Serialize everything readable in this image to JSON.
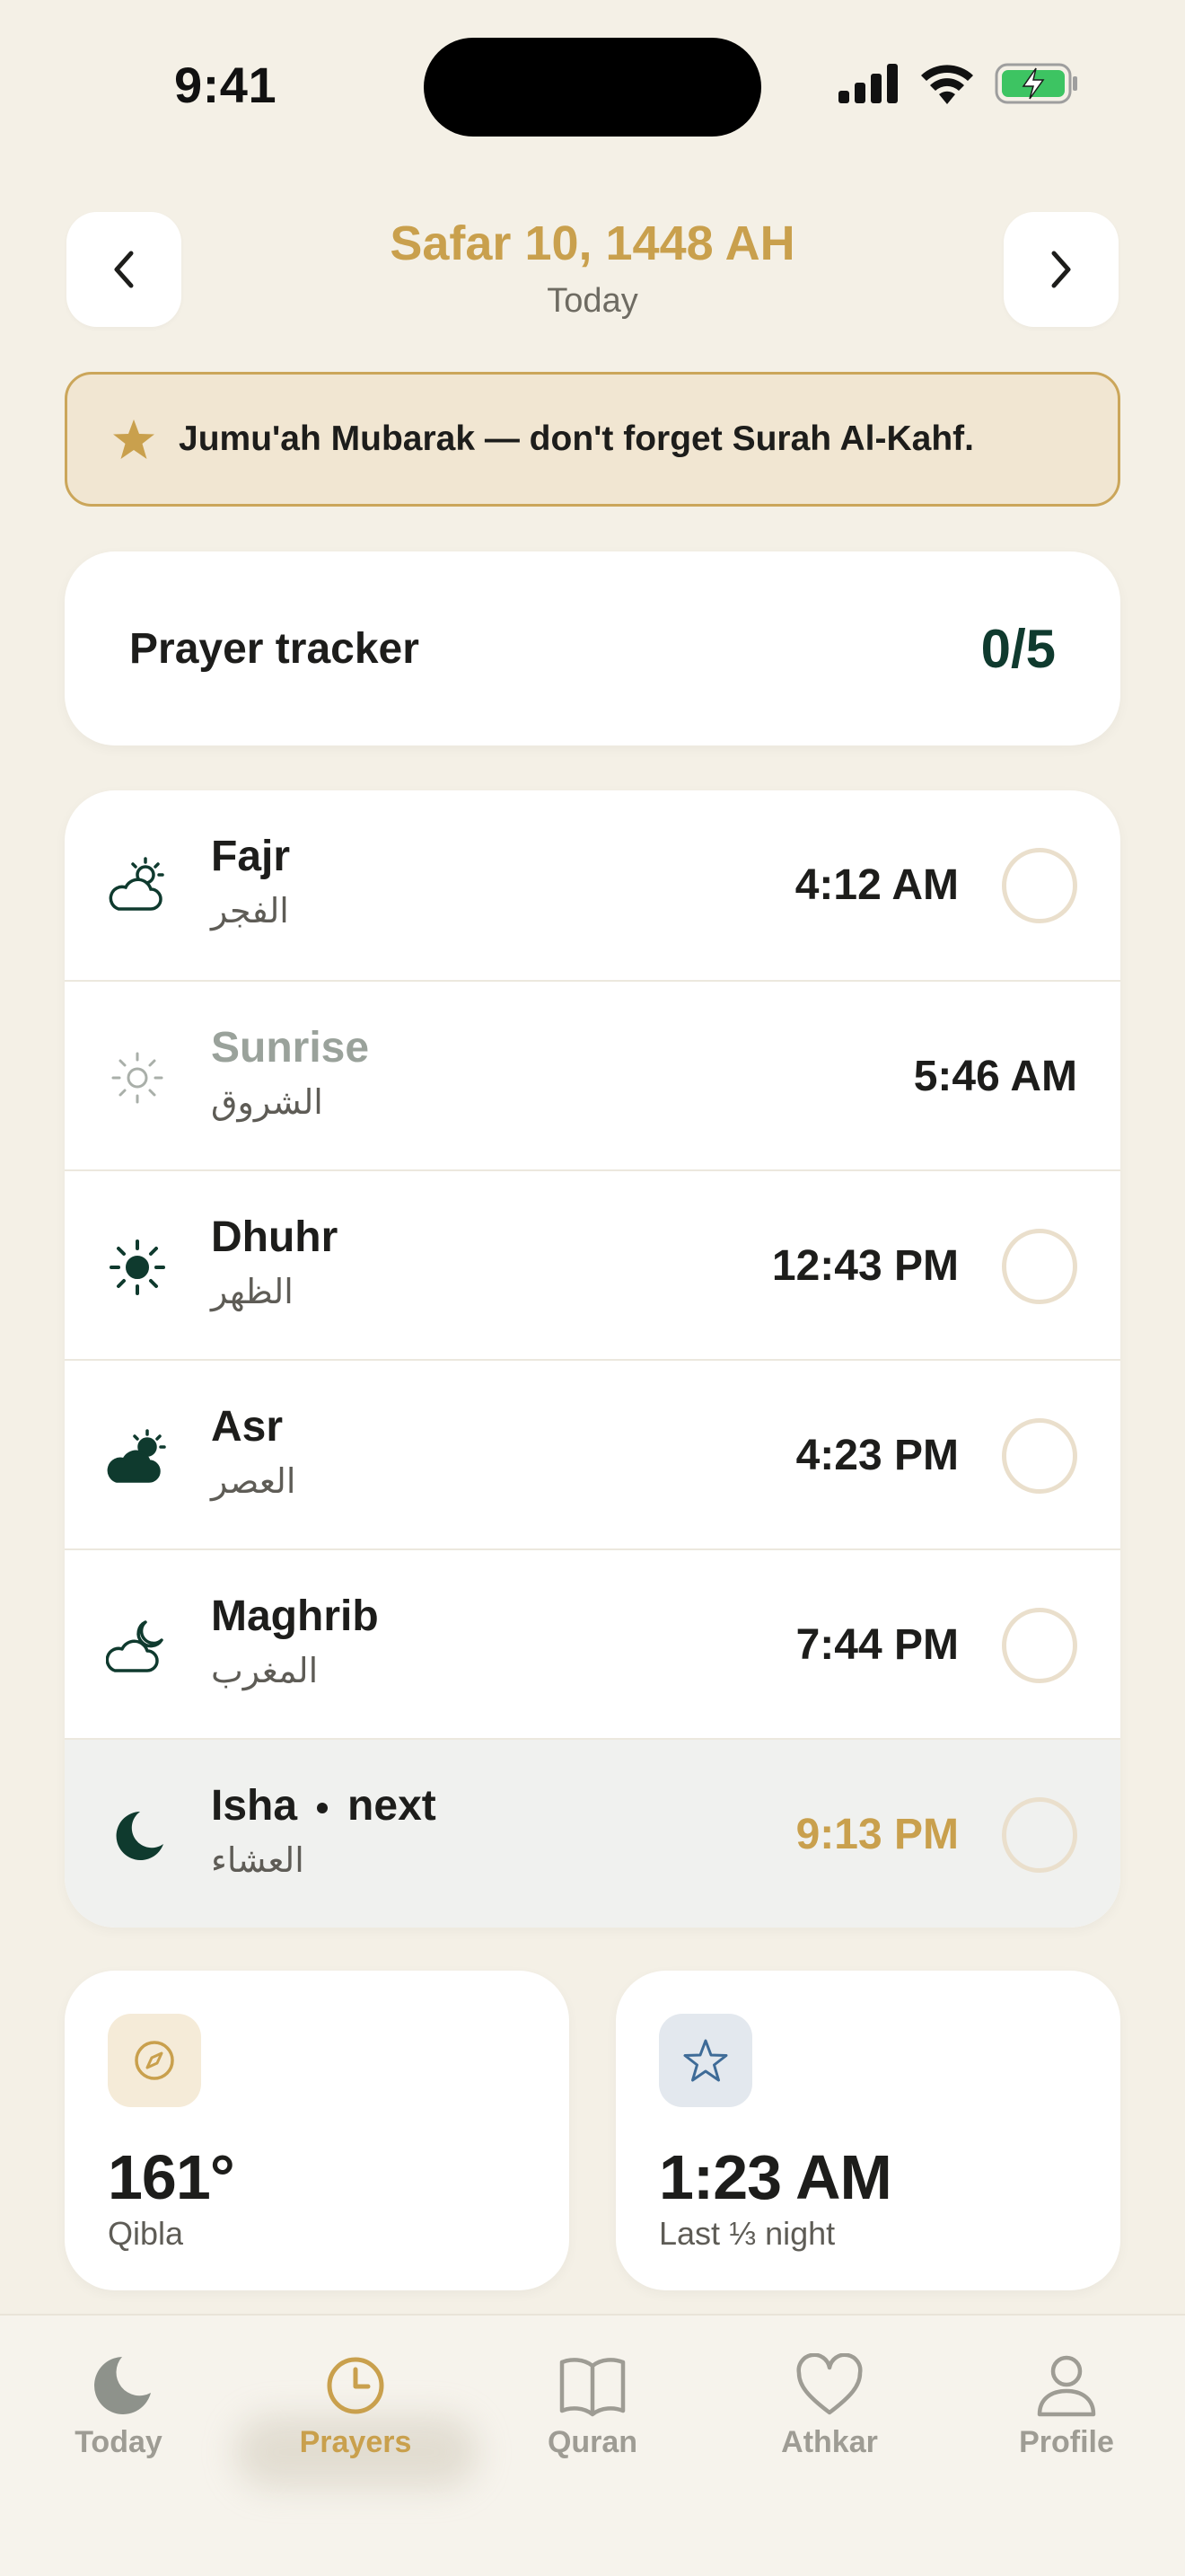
{
  "status_bar": {
    "time": "9:41"
  },
  "header": {
    "date": "Safar 10, 1448 AH",
    "subtitle": "Today",
    "prev_icon": "chevron-left-icon",
    "next_icon": "chevron-right-icon"
  },
  "banner": {
    "icon": "star-icon",
    "text": "Jumu'ah Mubarak — don't forget Surah Al-Kahf."
  },
  "tracker": {
    "label": "Prayer tracker",
    "count": "0/5"
  },
  "prayers": [
    {
      "name": "Fajr",
      "arabic": "الفجر",
      "time": "4:12 AM",
      "icon": "cloud-sun-icon",
      "checked": false
    },
    {
      "name": "Sunrise",
      "arabic": "الشروق",
      "time": "5:46 AM",
      "icon": "sun-outline-icon"
    },
    {
      "name": "Dhuhr",
      "arabic": "الظهر",
      "time": "12:43 PM",
      "icon": "sun-icon",
      "checked": false
    },
    {
      "name": "Asr",
      "arabic": "العصر",
      "time": "4:23 PM",
      "icon": "cloud-sun-filled-icon",
      "checked": false
    },
    {
      "name": "Maghrib",
      "arabic": "المغرب",
      "time": "7:44 PM",
      "icon": "cloud-moon-icon",
      "checked": false
    },
    {
      "name": "Isha",
      "next_label": "next",
      "arabic": "العشاء",
      "time": "9:13 PM",
      "icon": "moon-icon",
      "checked": false
    }
  ],
  "cards": {
    "qibla": {
      "value": "161°",
      "label": "Qibla",
      "icon": "compass-icon"
    },
    "night": {
      "value": "1:23 AM",
      "label": "Last ⅓ night",
      "icon": "star-outline-icon"
    }
  },
  "tabs": [
    {
      "label": "Today",
      "icon": "moon-icon"
    },
    {
      "label": "Prayers",
      "icon": "clock-icon",
      "active": true
    },
    {
      "label": "Quran",
      "icon": "book-icon"
    },
    {
      "label": "Athkar",
      "icon": "heart-icon"
    },
    {
      "label": "Profile",
      "icon": "person-icon"
    }
  ],
  "colors": {
    "background": "#F4F0E6",
    "accent_gold": "#C9A04D",
    "deep_green": "#0F3A2E",
    "banner_bg": "#F1E6D2"
  }
}
